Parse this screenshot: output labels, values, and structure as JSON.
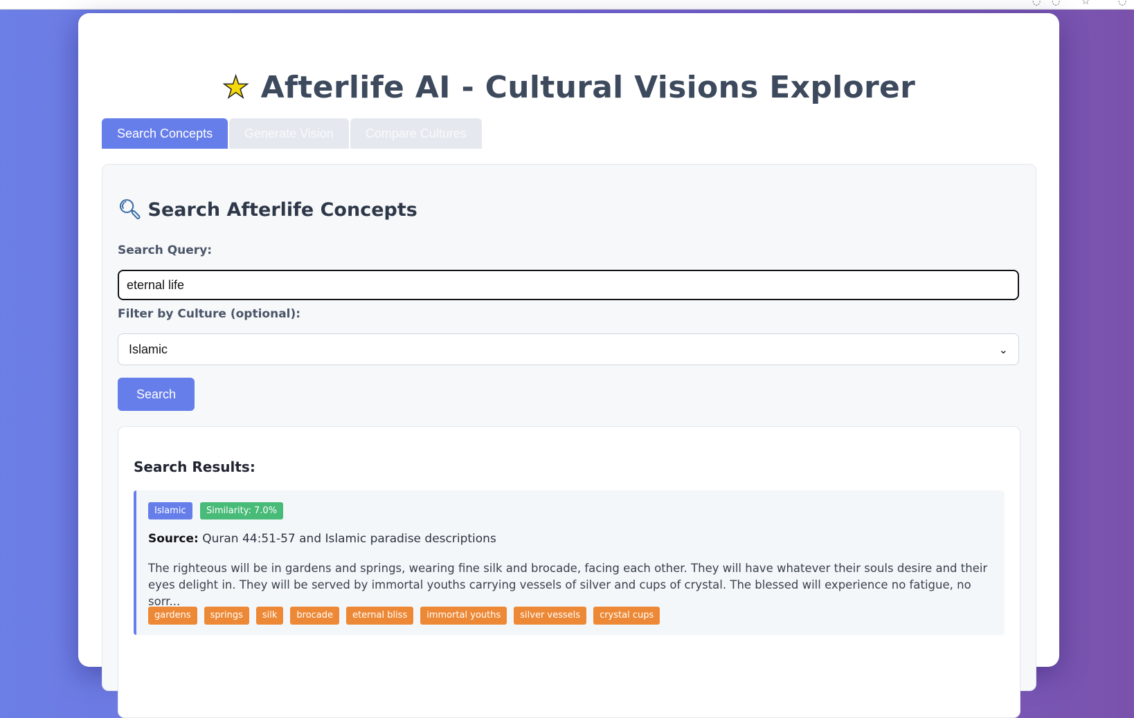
{
  "header": {
    "title": "Afterlife AI - Cultural Visions Explorer",
    "title_icon": "star-icon"
  },
  "tabs": [
    {
      "label": "Search Concepts",
      "active": true
    },
    {
      "label": "Generate Vision",
      "active": false
    },
    {
      "label": "Compare Cultures",
      "active": false
    }
  ],
  "search_panel": {
    "heading": "Search Afterlife Concepts",
    "heading_icon": "magnifier-icon",
    "query_label": "Search Query:",
    "query_value": "eternal life",
    "culture_label": "Filter by Culture (optional):",
    "culture_selected": "Islamic",
    "search_button": "Search"
  },
  "results": {
    "heading": "Search Results:",
    "items": [
      {
        "culture": "Islamic",
        "similarity": "Similarity: 7.0%",
        "source_label": "Source:",
        "source": "Quran 44:51-57 and Islamic paradise descriptions",
        "description": "The righteous will be in gardens and springs, wearing fine silk and brocade, facing each other. They will have whatever their souls desire and their eyes delight in. They will be served by immortal youths carrying vessels of silver and cups of crystal. The blessed will experience no fatigue, no sorr...",
        "tags": [
          "gardens",
          "springs",
          "silk",
          "brocade",
          "eternal bliss",
          "immortal youths",
          "silver vessels",
          "crystal cups"
        ]
      }
    ]
  },
  "colors": {
    "accent": "#667eea",
    "similarity_badge": "#48bb78",
    "tag": "#ed8936",
    "title_text": "#3d4a5d"
  }
}
